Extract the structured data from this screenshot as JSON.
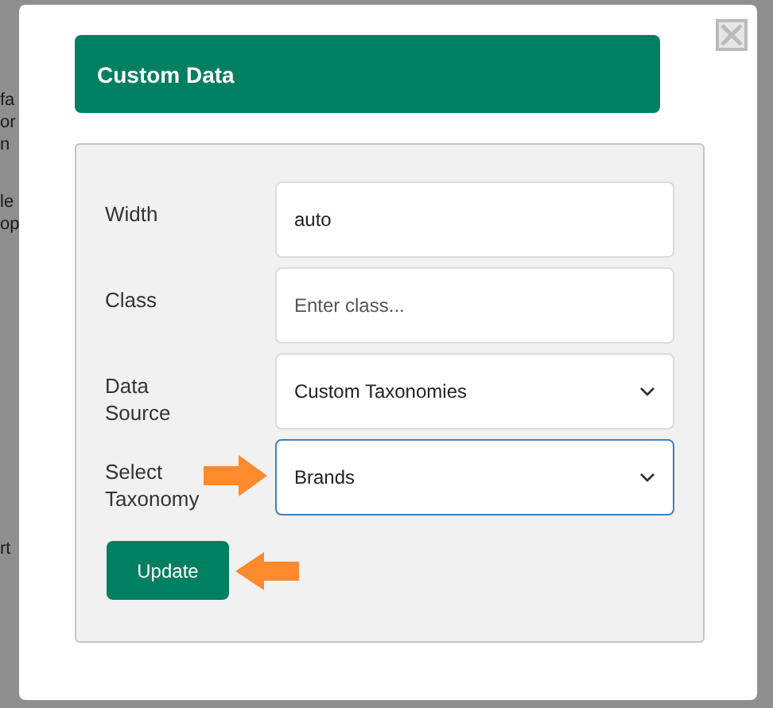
{
  "background": {
    "fragments": [
      "fa",
      "or",
      "n",
      "le",
      "op",
      "rt"
    ]
  },
  "dialog": {
    "title": "Custom Data",
    "fields": [
      {
        "label": "Width",
        "kind": "input",
        "value": "auto",
        "focused": false
      },
      {
        "label": "Class",
        "kind": "input",
        "placeholder": "Enter class...",
        "focused": false
      },
      {
        "label": "Data Source",
        "kind": "select",
        "value": "Custom Taxonomies",
        "focused": false
      },
      {
        "label": "Select Taxonomy",
        "kind": "select",
        "value": "Brands",
        "focused": true
      }
    ],
    "button": "Update"
  }
}
